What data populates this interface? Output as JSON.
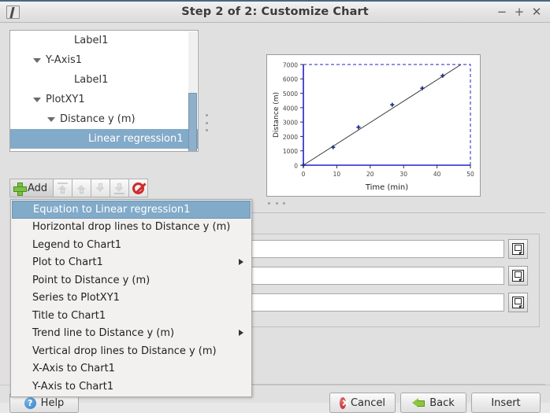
{
  "window": {
    "title": "Step 2 of 2: Customize Chart",
    "app_icon": "chart-wizard-icon",
    "controls": {
      "minimize": "−",
      "maximize": "+",
      "close": "✕"
    }
  },
  "tree": {
    "items": [
      {
        "label": "Label1",
        "depth": 3,
        "twisty": "none",
        "selected": false
      },
      {
        "label": "Y-Axis1",
        "depth": 1,
        "twisty": "open",
        "selected": false
      },
      {
        "label": "Label1",
        "depth": 3,
        "twisty": "none",
        "selected": false
      },
      {
        "label": "PlotXY1",
        "depth": 1,
        "twisty": "open",
        "selected": false
      },
      {
        "label": "Distance y (m)",
        "depth": 2,
        "twisty": "open",
        "selected": false
      },
      {
        "label": "Linear regression1",
        "depth": 4,
        "twisty": "none",
        "selected": true
      }
    ],
    "scrollbar": "vertical-scrollbar"
  },
  "toolbar": {
    "add_label": "Add",
    "buttons": [
      {
        "name": "add-button",
        "icon": "plus-icon",
        "enabled": true
      },
      {
        "name": "move-to-top-button",
        "icon": "arrow-to-top-icon",
        "enabled": false
      },
      {
        "name": "move-up-button",
        "icon": "arrow-up-icon",
        "enabled": false
      },
      {
        "name": "move-down-button",
        "icon": "arrow-down-icon",
        "enabled": false
      },
      {
        "name": "move-to-bottom-button",
        "icon": "arrow-to-bottom-icon",
        "enabled": false
      },
      {
        "name": "delete-button",
        "icon": "prohibition-icon",
        "enabled": true
      }
    ]
  },
  "menu": {
    "items": [
      {
        "label": "Equation to Linear regression1",
        "selected": true,
        "submenu": false
      },
      {
        "label": "Horizontal drop lines to Distance y (m)",
        "selected": false,
        "submenu": false
      },
      {
        "label": "Legend to Chart1",
        "selected": false,
        "submenu": false
      },
      {
        "label": "Plot to Chart1",
        "selected": false,
        "submenu": true
      },
      {
        "label": "Point to Distance y (m)",
        "selected": false,
        "submenu": false
      },
      {
        "label": "Series to PlotXY1",
        "selected": false,
        "submenu": false
      },
      {
        "label": "Title to Chart1",
        "selected": false,
        "submenu": false
      },
      {
        "label": "Trend line to Distance y (m)",
        "selected": false,
        "submenu": true
      },
      {
        "label": "Vertical drop lines to Distance y (m)",
        "selected": false,
        "submenu": false
      },
      {
        "label": "X-Axis to Chart1",
        "selected": false,
        "submenu": false
      },
      {
        "label": "Y-Axis to Chart1",
        "selected": false,
        "submenu": false
      }
    ]
  },
  "fields": {
    "rows": [
      {
        "name": "range-field-1",
        "value": "",
        "picker": "select-range-icon"
      },
      {
        "name": "range-field-2",
        "value": "",
        "picker": "select-range-icon"
      },
      {
        "name": "range-field-3",
        "value": "",
        "picker": "select-range-icon"
      }
    ]
  },
  "buttons": {
    "help": "Help",
    "cancel": "Cancel",
    "back": "Back",
    "insert": "Insert"
  },
  "colors": {
    "selection_blue": "#82aac9",
    "series_blue": "#1f2f8f",
    "axis_blue": "#2222cc",
    "window_bg": "#e0e0e0",
    "accent_green": "#8dc63f",
    "accent_red": "#c0282d"
  },
  "chart_data": {
    "type": "scatter",
    "title": "",
    "xlabel": "Time (min)",
    "ylabel": "Distance (m)",
    "xlim": [
      0,
      50
    ],
    "ylim": [
      0,
      7000
    ],
    "xticks": [
      0,
      10,
      20,
      30,
      40,
      50
    ],
    "yticks": [
      0,
      1000,
      2000,
      3000,
      4000,
      5000,
      6000,
      7000
    ],
    "grid": false,
    "legend": "none",
    "series": [
      {
        "name": "Distance y (m)",
        "marker": "plus",
        "color": "#1f2f8f",
        "x": [
          0.0,
          8.9,
          16.5,
          26.6,
          35.6,
          41.7
        ],
        "y": [
          0,
          1250,
          2640,
          4200,
          5350,
          6220
        ]
      },
      {
        "name": "Linear regression1",
        "type": "line",
        "color": "#333333",
        "x": [
          0,
          47.2
        ],
        "y": [
          0,
          7000
        ]
      }
    ],
    "selection_rect": {
      "x": [
        0,
        50
      ],
      "y": [
        0,
        7000
      ],
      "style": "dashed",
      "color": "#2222cc"
    }
  }
}
